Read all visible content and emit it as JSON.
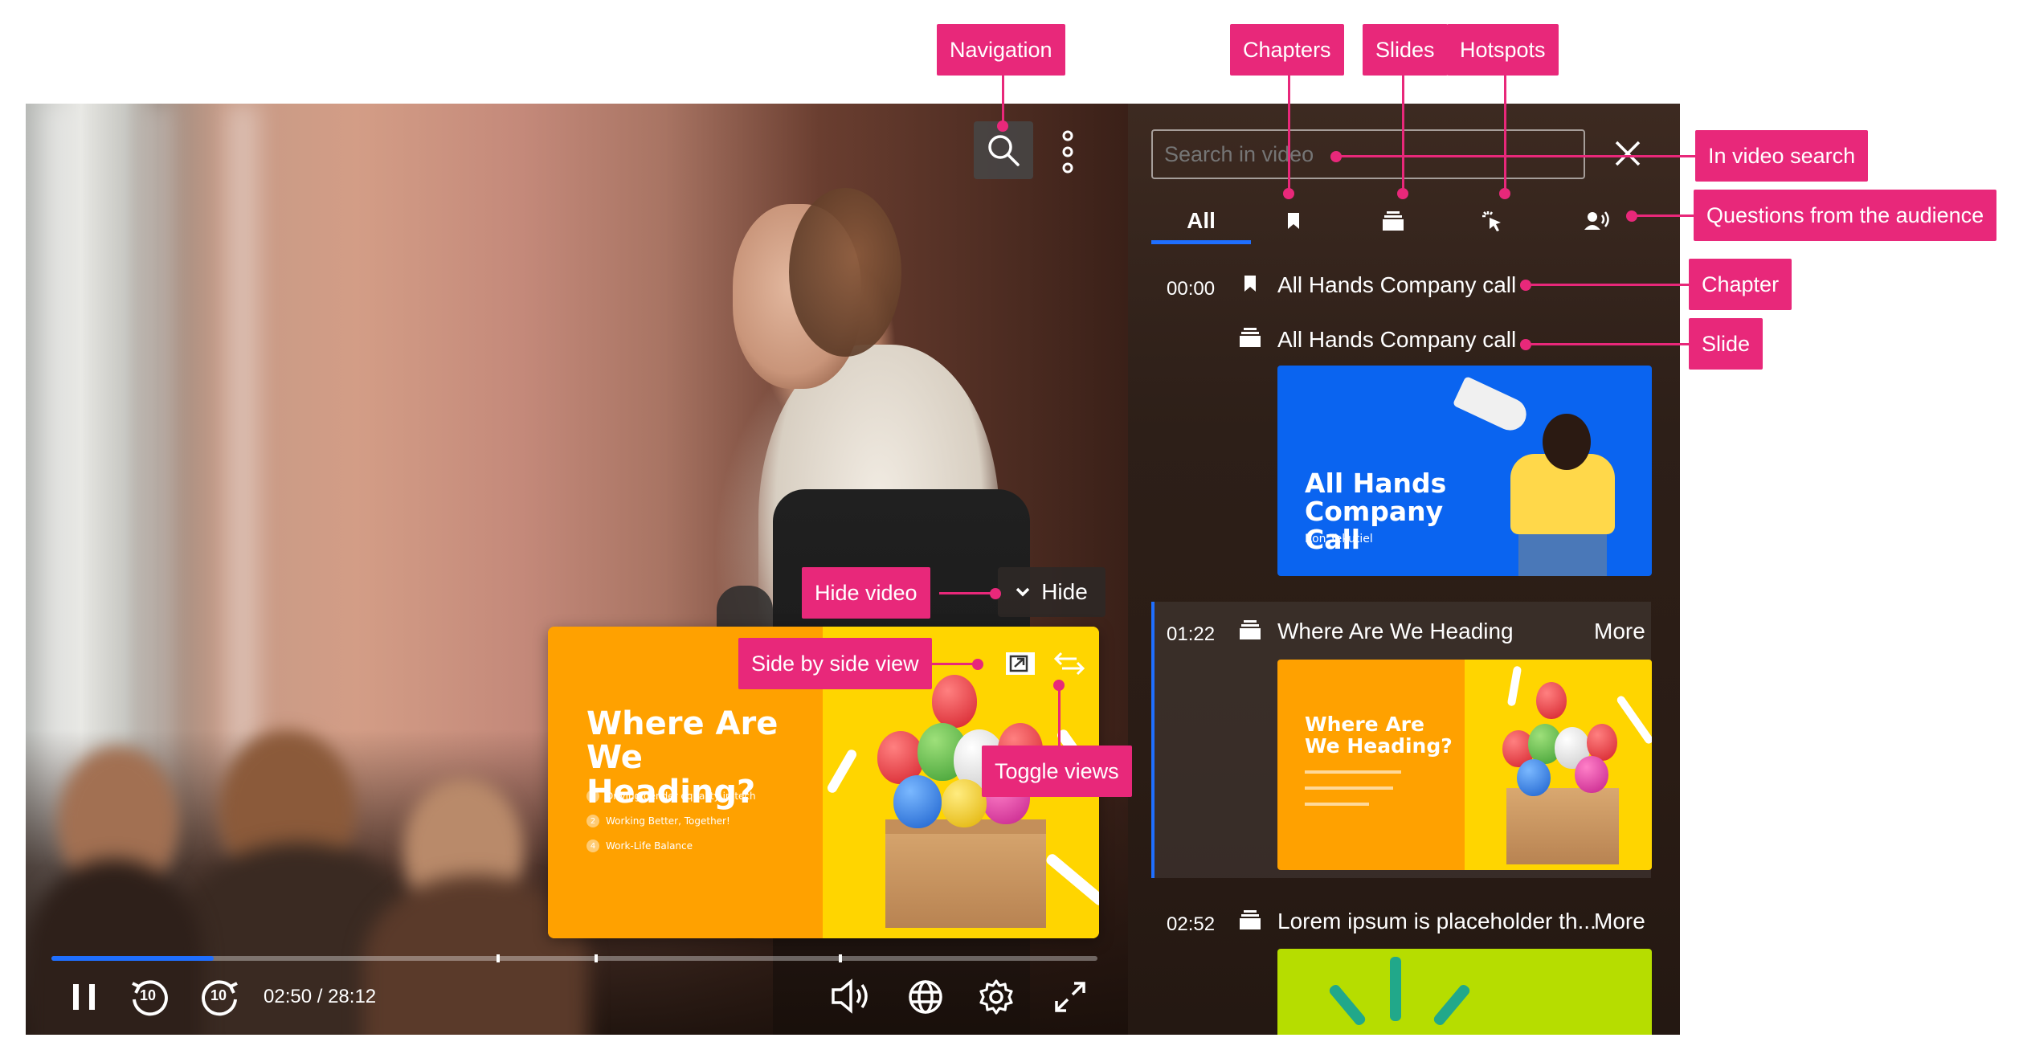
{
  "callouts": {
    "navigation": "Navigation",
    "chapters": "Chapters",
    "slides": "Slides",
    "hotspots": "Hotspots",
    "in_video_search": "In video search",
    "questions_audience": "Questions from the audience",
    "chapter": "Chapter",
    "slide": "Slide",
    "hide_video": "Hide video",
    "side_by_side": "Side by side view",
    "toggle_views": "Toggle views"
  },
  "player": {
    "time_current": "02:50",
    "time_separator": " / ",
    "time_total": "28:12",
    "progress_fraction": 0.155,
    "skip_back_label": "10",
    "skip_forward_label": "10",
    "hide_button_label": "Hide"
  },
  "pip_slide": {
    "title": "Where Are We Heading?",
    "bullets": [
      {
        "num": "1",
        "text": "Driving gender equality in tech"
      },
      {
        "num": "2",
        "text": "Working Better, Together!"
      },
      {
        "num": "4",
        "text": "Work-Life Balance"
      }
    ]
  },
  "side_panel": {
    "search_placeholder": "Search in video",
    "tabs": {
      "all": "All"
    },
    "entries": [
      {
        "time": "00:00",
        "type": "chapter",
        "title": "All Hands Company call"
      },
      {
        "time": "",
        "type": "slide",
        "title": "All Hands Company call",
        "thumb": {
          "title": "All Hands Company Call",
          "subtitle": "Ron Yekutiel"
        }
      },
      {
        "time": "01:22",
        "type": "slide",
        "title": "Where Are We Heading",
        "more": "More",
        "thumb": {
          "title": "Where Are We Heading?"
        }
      },
      {
        "time": "02:52",
        "type": "slide",
        "title": "Lorem ipsum is placeholder th...",
        "more": "More"
      }
    ]
  },
  "colors": {
    "callout": "#e8287a",
    "accent": "#1f6fff",
    "slide_orange": "#ffa100",
    "slide_yellow": "#ffd500",
    "slide_blue": "#0a64f0",
    "slide_green": "#b6dd00"
  }
}
